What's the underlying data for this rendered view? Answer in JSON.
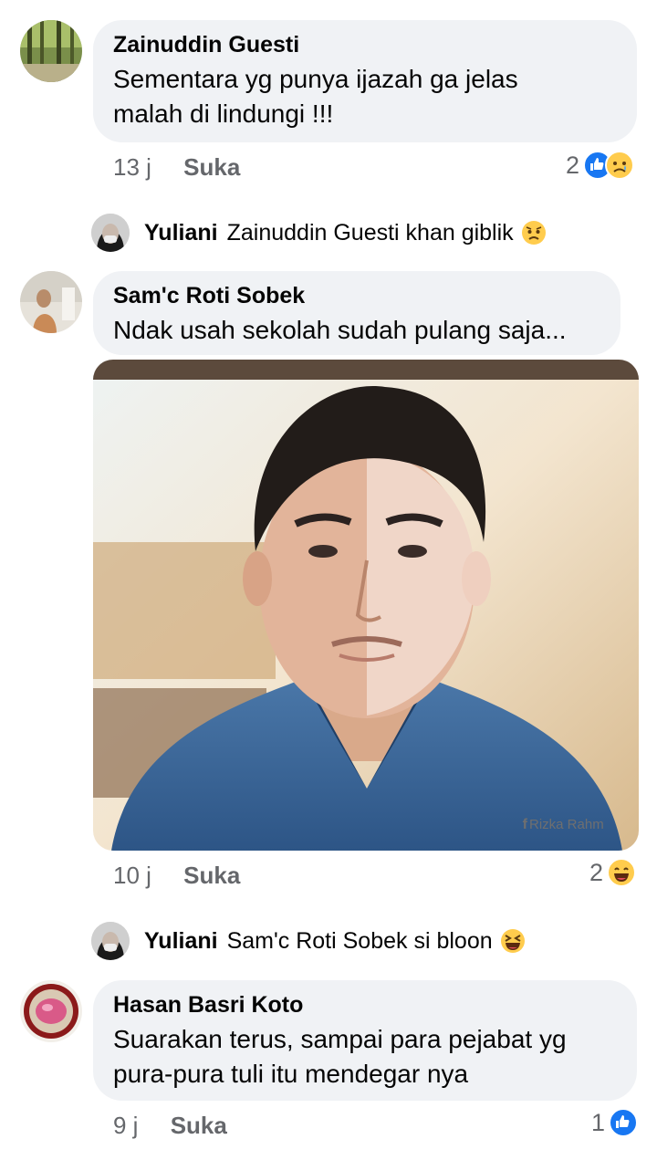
{
  "comments": [
    {
      "author": "Zainuddin Guesti",
      "text": "Sementara yg punya ijazah ga jelas\nmalah di lindungi !!!",
      "time": "13 j",
      "like_label": "Suka",
      "reaction_count": "2",
      "reactions": [
        "like-icon",
        "sad-face-icon"
      ]
    },
    {
      "author": "Sam'c Roti Sobek",
      "text": "Ndak usah sekolah sudah pulang saja...",
      "time": "10 j",
      "like_label": "Suka",
      "reaction_count": "2",
      "reactions": [
        "laughing-face-icon"
      ],
      "image_watermark": "Rizka Rahm"
    },
    {
      "author": "Hasan Basri Koto",
      "text": "Suarakan terus, sampai para pejabat yg\npura-pura tuli itu mendegar nya",
      "time": "9 j",
      "like_label": "Suka",
      "reaction_count": "1",
      "reactions": [
        "like-icon"
      ]
    }
  ],
  "replies": [
    {
      "author": "Yuliani",
      "text": "Zainuddin Guesti khan giblik",
      "emoji": "worried-face-icon"
    },
    {
      "author": "Yuliani",
      "text": "Sam'c Roti Sobek si bloon",
      "emoji": "squinting-laugh-icon"
    }
  ],
  "colors": {
    "bubble": "#f0f2f5",
    "meta_text": "#65676b",
    "like_blue": "#1877f2",
    "emoji_yellow": "#ffcc4d"
  }
}
